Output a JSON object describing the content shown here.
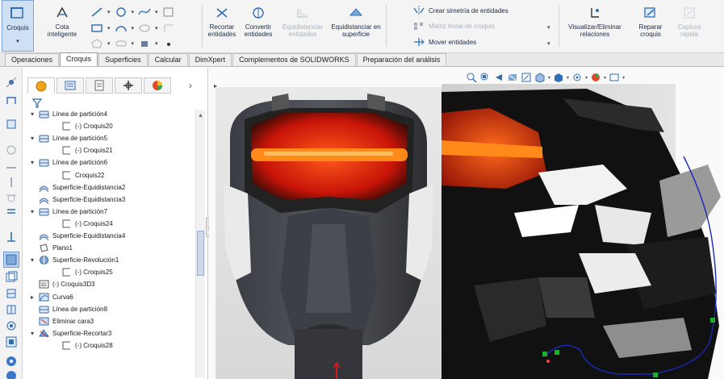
{
  "ribbon": {
    "croquis": "Croquis",
    "cota_inteligente": "Cota inteligente",
    "recortar": "Recortar entidades",
    "convertir": "Convertir entidades",
    "equidistanciar_entidades": "Equidistanciar entidades",
    "equidistanciar_superficie": "Equidistanciar en superficie",
    "crear_simetria": "Crear simetría de entidades",
    "matriz_lineal": "Matriz lineal de croquis",
    "mover_entidades": "Mover entidades",
    "visualizar_relaciones": "Visualizar/Eliminar relaciones",
    "reparar": "Reparar croquis",
    "captura": "Captura rápida"
  },
  "tabs": [
    "Operaciones",
    "Croquis",
    "Superficies",
    "Calcular",
    "DimXpert",
    "Complementos de SOLIDWORKS",
    "Preparación del análisis"
  ],
  "active_tab_index": 1,
  "feature_tree": [
    {
      "label": "Línea de partición4",
      "icon": "split-line-icon",
      "level": 1,
      "expand": "collapse"
    },
    {
      "label": "(-) Croquis20",
      "icon": "sketch-icon",
      "level": 2,
      "expand": ""
    },
    {
      "label": "Línea de partición5",
      "icon": "split-line-icon",
      "level": 1,
      "expand": "collapse"
    },
    {
      "label": "(-) Croquis21",
      "icon": "sketch-icon",
      "level": 2,
      "expand": ""
    },
    {
      "label": "Línea de partición6",
      "icon": "split-line-icon",
      "level": 1,
      "expand": "collapse"
    },
    {
      "label": "Croquis22",
      "icon": "sketch-icon",
      "level": 2,
      "expand": ""
    },
    {
      "label": "Superficie-Equidistancia2",
      "icon": "offset-surface-icon",
      "level": 1,
      "expand": ""
    },
    {
      "label": "Superficie-Equidistancia3",
      "icon": "offset-surface-icon",
      "level": 1,
      "expand": ""
    },
    {
      "label": "Línea de partición7",
      "icon": "split-line-icon",
      "level": 1,
      "expand": "collapse"
    },
    {
      "label": "(-) Croquis24",
      "icon": "sketch-icon",
      "level": 2,
      "expand": ""
    },
    {
      "label": "Superficie-Equidistancia4",
      "icon": "offset-surface-icon",
      "level": 1,
      "expand": ""
    },
    {
      "label": "Plano1",
      "icon": "plane-icon",
      "level": 1,
      "expand": ""
    },
    {
      "label": "Superficie-Revolución1",
      "icon": "revolve-surface-icon",
      "level": 1,
      "expand": "collapse"
    },
    {
      "label": "(-) Croquis25",
      "icon": "sketch-icon",
      "level": 2,
      "expand": ""
    },
    {
      "label": "(-) Croquis3D3",
      "icon": "sketch3d-icon",
      "level": 1,
      "expand": ""
    },
    {
      "label": "Curva6",
      "icon": "curve-icon",
      "level": 1,
      "expand": "expand"
    },
    {
      "label": "Línea de partición8",
      "icon": "split-line-icon",
      "level": 1,
      "expand": ""
    },
    {
      "label": "Eliminar cara3",
      "icon": "delete-face-icon",
      "level": 1,
      "expand": ""
    },
    {
      "label": "Superficie-Recortar3",
      "icon": "trim-surface-icon",
      "level": 1,
      "expand": "collapse"
    },
    {
      "label": "(-) Croquis28",
      "icon": "sketch-icon",
      "level": 2,
      "expand": ""
    }
  ],
  "colors": {
    "accent": "#2f6db5",
    "visor_orange": "#ff8a1a",
    "visor_red": "#c81408",
    "sketch_blue": "#1a2ab8",
    "point_green": "#18b02a"
  }
}
